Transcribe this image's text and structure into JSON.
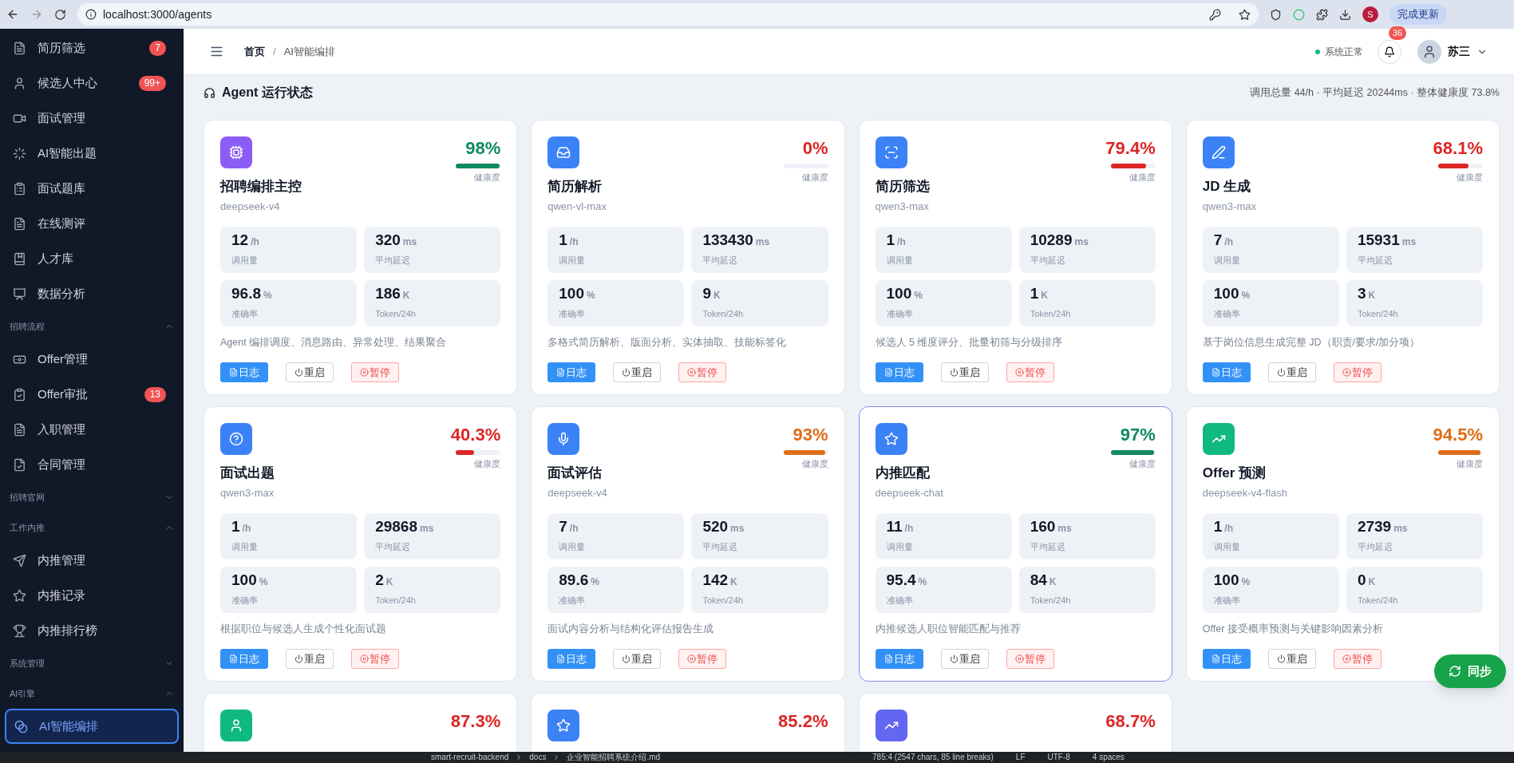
{
  "browser": {
    "url": "localhost:3000/agents",
    "profile_initial": "S",
    "update_button": "完成更新"
  },
  "sidebar": [
    {
      "kind": "item",
      "label": "简历筛选",
      "badge": "7",
      "selected": false
    },
    {
      "kind": "item",
      "label": "候选人中心",
      "badge": "99+",
      "selected": false
    },
    {
      "kind": "item",
      "label": "面试管理",
      "selected": false
    },
    {
      "kind": "item",
      "label": "AI智能出题",
      "selected": false
    },
    {
      "kind": "item",
      "label": "面试题库",
      "selected": false
    },
    {
      "kind": "item",
      "label": "在线测评",
      "selected": false
    },
    {
      "kind": "item",
      "label": "人才库",
      "selected": false
    },
    {
      "kind": "item",
      "label": "数据分析",
      "selected": false
    },
    {
      "kind": "section",
      "label": "招聘流程",
      "expanded": true
    },
    {
      "kind": "item",
      "label": "Offer管理",
      "selected": false
    },
    {
      "kind": "item",
      "label": "Offer审批",
      "badge": "13",
      "selected": false
    },
    {
      "kind": "item",
      "label": "入职管理",
      "selected": false
    },
    {
      "kind": "item",
      "label": "合同管理",
      "selected": false
    },
    {
      "kind": "section",
      "label": "招聘官网",
      "expanded": false
    },
    {
      "kind": "section",
      "label": "工作内推",
      "expanded": true
    },
    {
      "kind": "item",
      "label": "内推管理",
      "selected": false
    },
    {
      "kind": "item",
      "label": "内推记录",
      "selected": false
    },
    {
      "kind": "item",
      "label": "内推排行榜",
      "selected": false
    },
    {
      "kind": "section",
      "label": "系统管理",
      "expanded": false
    },
    {
      "kind": "section",
      "label": "AI引擎",
      "expanded": true
    },
    {
      "kind": "item",
      "label": "AI智能编排",
      "selected": true
    }
  ],
  "header": {
    "breadcrumb": [
      "首页",
      "AI智能编排"
    ],
    "breadcrumb_separator": "/",
    "system_status": "系统正常",
    "notifications": "36",
    "user": "苏三"
  },
  "section": {
    "title": "Agent 运行状态",
    "summary": "调用总量 44/h · 平均延迟 20244ms · 整体健康度 73.8%"
  },
  "agents": [
    {
      "name": "招聘编排主控",
      "model": "deepseek-v4",
      "health": "98%",
      "level": 0.98,
      "health_label": "健康度",
      "color": "#8b5cf6",
      "selected": false,
      "stats": [
        {
          "value": "12",
          "unit": "/h",
          "label": "调用量"
        },
        {
          "value": "320",
          "unit": "ms",
          "label": "平均延迟"
        },
        {
          "value": "96.8",
          "unit": "%",
          "label": "准确率"
        },
        {
          "value": "186",
          "unit": "K",
          "label": "Token/24h"
        }
      ],
      "description": "Agent 编排调度、消息路由、异常处理、结果聚合",
      "actions": [
        {
          "kind": "log",
          "label": "日志"
        },
        {
          "kind": "restart",
          "label": "重启"
        },
        {
          "kind": "pause",
          "label": "暂停"
        }
      ]
    },
    {
      "name": "简历解析",
      "model": "qwen-vl-max",
      "health": "0%",
      "level": 0,
      "health_label": "健康度",
      "color": "#3b82f6",
      "selected": false,
      "stats": [
        {
          "value": "1",
          "unit": "/h",
          "label": "调用量"
        },
        {
          "value": "133430",
          "unit": "ms",
          "label": "平均延迟"
        },
        {
          "value": "100",
          "unit": "%",
          "label": "准确率"
        },
        {
          "value": "9",
          "unit": "K",
          "label": "Token/24h"
        }
      ],
      "description": "多格式简历解析、版面分析、实体抽取、技能标签化",
      "actions": [
        {
          "kind": "log",
          "label": "日志"
        },
        {
          "kind": "restart",
          "label": "重启"
        },
        {
          "kind": "pause",
          "label": "暂停"
        }
      ]
    },
    {
      "name": "简历筛选",
      "model": "qwen3-max",
      "health": "79.4%",
      "level": 0.794,
      "health_label": "健康度",
      "color": "#3b82f6",
      "selected": false,
      "stats": [
        {
          "value": "1",
          "unit": "/h",
          "label": "调用量"
        },
        {
          "value": "10289",
          "unit": "ms",
          "label": "平均延迟"
        },
        {
          "value": "100",
          "unit": "%",
          "label": "准确率"
        },
        {
          "value": "1",
          "unit": "K",
          "label": "Token/24h"
        }
      ],
      "description": "候选人 5 维度评分、批量初筛与分级排序",
      "actions": [
        {
          "kind": "log",
          "label": "日志"
        },
        {
          "kind": "restart",
          "label": "重启"
        },
        {
          "kind": "pause",
          "label": "暂停"
        }
      ]
    },
    {
      "name": "JD 生成",
      "model": "qwen3-max",
      "health": "68.1%",
      "level": 0.681,
      "health_label": "健康度",
      "color": "#3b82f6",
      "selected": false,
      "stats": [
        {
          "value": "7",
          "unit": "/h",
          "label": "调用量"
        },
        {
          "value": "15931",
          "unit": "ms",
          "label": "平均延迟"
        },
        {
          "value": "100",
          "unit": "%",
          "label": "准确率"
        },
        {
          "value": "3",
          "unit": "K",
          "label": "Token/24h"
        }
      ],
      "description": "基于岗位信息生成完整 JD（职责/要求/加分项）",
      "actions": [
        {
          "kind": "log",
          "label": "日志"
        },
        {
          "kind": "restart",
          "label": "重启"
        },
        {
          "kind": "pause",
          "label": "暂停"
        }
      ]
    },
    {
      "name": "面试出题",
      "model": "qwen3-max",
      "health": "40.3%",
      "level": 0.403,
      "health_label": "健康度",
      "color": "#3b82f6",
      "selected": false,
      "stats": [
        {
          "value": "1",
          "unit": "/h",
          "label": "调用量"
        },
        {
          "value": "29868",
          "unit": "ms",
          "label": "平均延迟"
        },
        {
          "value": "100",
          "unit": "%",
          "label": "准确率"
        },
        {
          "value": "2",
          "unit": "K",
          "label": "Token/24h"
        }
      ],
      "description": "根据职位与候选人生成个性化面试题",
      "actions": [
        {
          "kind": "log",
          "label": "日志"
        },
        {
          "kind": "restart",
          "label": "重启"
        },
        {
          "kind": "pause",
          "label": "暂停"
        }
      ]
    },
    {
      "name": "面试评估",
      "model": "deepseek-v4",
      "health": "93%",
      "level": 0.93,
      "health_label": "健康度",
      "color": "#3b82f6",
      "selected": false,
      "stats": [
        {
          "value": "7",
          "unit": "/h",
          "label": "调用量"
        },
        {
          "value": "520",
          "unit": "ms",
          "label": "平均延迟"
        },
        {
          "value": "89.6",
          "unit": "%",
          "label": "准确率"
        },
        {
          "value": "142",
          "unit": "K",
          "label": "Token/24h"
        }
      ],
      "description": "面试内容分析与结构化评估报告生成",
      "actions": [
        {
          "kind": "log",
          "label": "日志"
        },
        {
          "kind": "restart",
          "label": "重启"
        },
        {
          "kind": "pause",
          "label": "暂停"
        }
      ]
    },
    {
      "name": "内推匹配",
      "model": "deepseek-chat",
      "health": "97%",
      "level": 0.97,
      "health_label": "健康度",
      "color": "#3b82f6",
      "selected": true,
      "stats": [
        {
          "value": "11",
          "unit": "/h",
          "label": "调用量"
        },
        {
          "value": "160",
          "unit": "ms",
          "label": "平均延迟"
        },
        {
          "value": "95.4",
          "unit": "%",
          "label": "准确率"
        },
        {
          "value": "84",
          "unit": "K",
          "label": "Token/24h"
        }
      ],
      "description": "内推候选人职位智能匹配与推荐",
      "actions": [
        {
          "kind": "log",
          "label": "日志"
        },
        {
          "kind": "restart",
          "label": "重启"
        },
        {
          "kind": "pause",
          "label": "暂停"
        }
      ]
    },
    {
      "name": "Offer 预测",
      "model": "deepseek-v4-flash",
      "health": "94.5%",
      "level": 0.945,
      "health_label": "健康度",
      "color": "#10b981",
      "selected": false,
      "stats": [
        {
          "value": "1",
          "unit": "/h",
          "label": "调用量"
        },
        {
          "value": "2739",
          "unit": "ms",
          "label": "平均延迟"
        },
        {
          "value": "100",
          "unit": "%",
          "label": "准确率"
        },
        {
          "value": "0",
          "unit": "K",
          "label": "Token/24h"
        }
      ],
      "description": "Offer 接受概率预测与关键影响因素分析",
      "actions": [
        {
          "kind": "log",
          "label": "日志"
        },
        {
          "kind": "restart",
          "label": "重启"
        },
        {
          "kind": "pause",
          "label": "暂停"
        }
      ]
    },
    {
      "health": "87.3%",
      "color": "#10b981",
      "selected": false
    },
    {
      "health": "85.2%",
      "color": "#3b82f6",
      "selected": false
    },
    {
      "health": "68.7%",
      "color": "#6366f1",
      "selected": false
    }
  ],
  "sync_button": "同步",
  "editor_status_bar": {
    "path": [
      "smart-recruit-backend",
      "docs",
      "企业智能招聘系统介绍.md"
    ],
    "items": [
      "785:4 (2547 chars, 85 line breaks)",
      "LF",
      "UTF-8",
      "4 spaces"
    ]
  }
}
